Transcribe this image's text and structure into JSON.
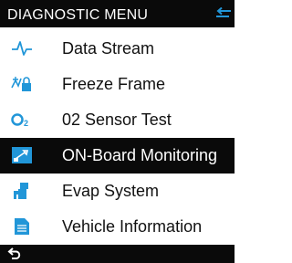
{
  "header": {
    "title": "DIAGNOSTIC MENU",
    "back_icon": "back-arrow-icon"
  },
  "menu": {
    "selected_index": 3,
    "items": [
      {
        "label": "Data Stream",
        "icon": "waveform-icon"
      },
      {
        "label": "Freeze Frame",
        "icon": "freeze-frame-icon"
      },
      {
        "label": "02 Sensor Test",
        "icon": "o2-sensor-icon"
      },
      {
        "label": "ON-Board Monitoring",
        "icon": "onboard-monitor-icon"
      },
      {
        "label": "Evap System",
        "icon": "fuel-pump-icon"
      },
      {
        "label": "Vehicle Information",
        "icon": "document-icon"
      }
    ]
  },
  "footer": {
    "back_icon": "return-arrow-icon"
  },
  "colors": {
    "bar": "#0a0a0a",
    "accent": "#2196d8",
    "text": "#111111"
  }
}
